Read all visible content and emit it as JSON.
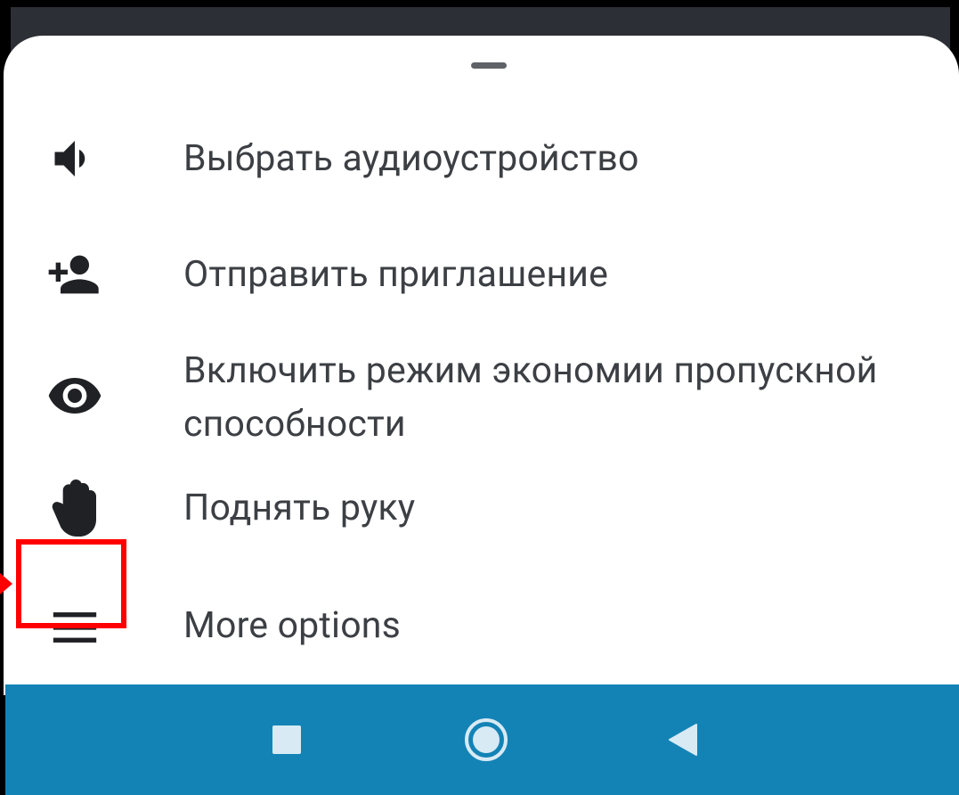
{
  "menu": {
    "items": [
      {
        "label": "Выбрать аудиоустройство",
        "icon": "volume-icon"
      },
      {
        "label": "Отправить приглашение",
        "icon": "person-add-icon"
      },
      {
        "label": "Включить режим экономии пропускной способности",
        "icon": "eye-icon"
      },
      {
        "label": "Поднять руку",
        "icon": "raise-hand-icon"
      },
      {
        "label": "More options",
        "icon": "menu-icon"
      }
    ]
  },
  "navigation": {
    "buttons": [
      {
        "name": "recents",
        "icon": "square-icon"
      },
      {
        "name": "home",
        "icon": "circle-icon"
      },
      {
        "name": "back",
        "icon": "triangle-back-icon"
      }
    ]
  },
  "colors": {
    "sheet_bg": "#ffffff",
    "text": "#3c3f43",
    "icon": "#202124",
    "nav_bar": "#1383b6",
    "nav_icons": "#d8eaf4",
    "highlight": "#ff0000"
  }
}
